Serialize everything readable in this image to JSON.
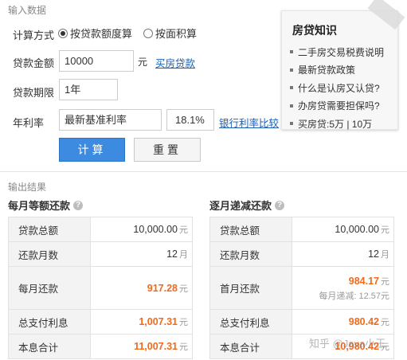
{
  "input": {
    "section_title": "输入数据",
    "calc_method_label": "计算方式",
    "calc_options": [
      "按贷款额度算",
      "按面积算"
    ],
    "loan_amount_label": "贷款金额",
    "loan_amount_value": "10000",
    "loan_amount_unit": "元",
    "buy_loan_link": "买房贷款",
    "loan_term_label": "贷款期限",
    "loan_term_value": "1年",
    "rate_label": "年利率",
    "rate_type_value": "最新基准利率",
    "rate_value": "18.1%",
    "rate_compare_link": "银行利率比较",
    "calc_button": "计算",
    "reset_button": "重置"
  },
  "knowledge": {
    "title": "房贷知识",
    "items": [
      "二手房交易税费说明",
      "最新贷款政策",
      "什么是认房又认贷?",
      "办房贷需要担保吗?",
      "买房贷:5万 | 10万"
    ]
  },
  "output": {
    "section_title": "输出结果",
    "unit": "元",
    "month_unit": "月",
    "equal": {
      "title": "每月等额还款",
      "rows": [
        {
          "label": "贷款总额",
          "value": "10,000.00"
        },
        {
          "label": "还款月数",
          "value": "12"
        },
        {
          "label": "每月还款",
          "value": "917.28"
        },
        {
          "label": "总支付利息",
          "value": "1,007.31"
        },
        {
          "label": "本息合计",
          "value": "11,007.31"
        }
      ]
    },
    "decreasing": {
      "title": "逐月递减还款",
      "rows": [
        {
          "label": "贷款总额",
          "value": "10,000.00"
        },
        {
          "label": "还款月数",
          "value": "12"
        },
        {
          "label": "首月还款",
          "value": "984.17"
        },
        {
          "label": "总支付利息",
          "value": "980.42"
        },
        {
          "label": "本息合计",
          "value": "10,980.42"
        }
      ],
      "decrease_label": "每月递减:",
      "decrease_value": "12.57"
    }
  },
  "watermark": "知乎 @Java小王"
}
